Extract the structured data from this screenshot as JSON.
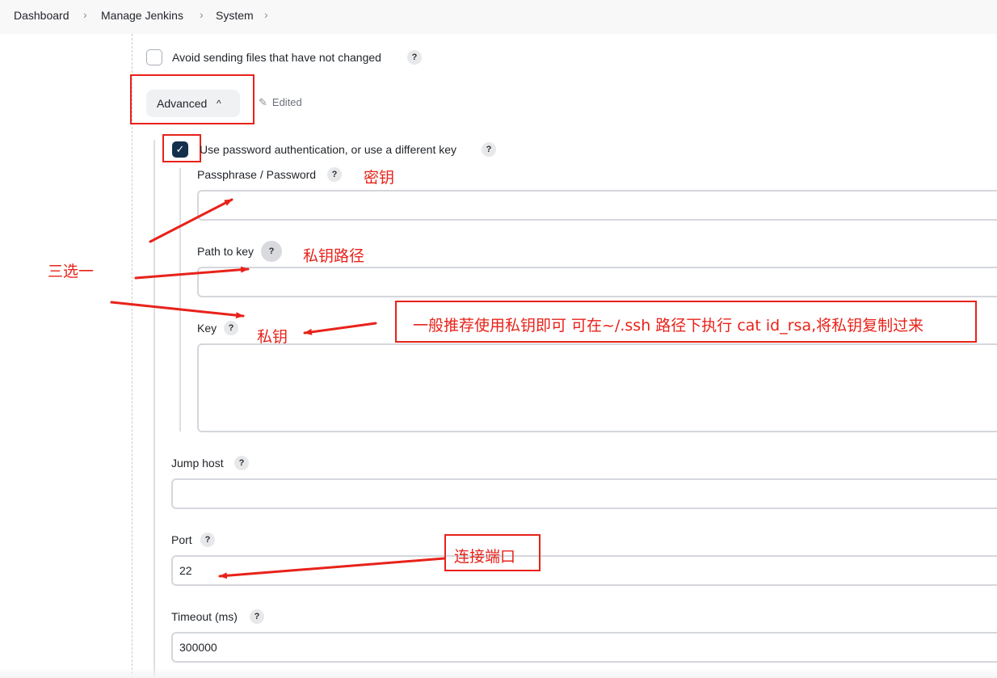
{
  "breadcrumb": {
    "items": [
      "Dashboard",
      "Manage Jenkins",
      "System"
    ]
  },
  "avoid_sending": {
    "label": "Avoid sending files that have not changed",
    "checked": false
  },
  "advanced": {
    "label": "Advanced",
    "edited_label": "Edited"
  },
  "use_password": {
    "label": "Use password authentication, or use a different key",
    "checked": true
  },
  "fields": {
    "passphrase": {
      "label": "Passphrase / Password",
      "value": ""
    },
    "path_to_key": {
      "label": "Path to key",
      "value": ""
    },
    "key": {
      "label": "Key",
      "value": ""
    },
    "jump_host": {
      "label": "Jump host",
      "value": ""
    },
    "port": {
      "label": "Port",
      "value": "22"
    },
    "timeout": {
      "label": "Timeout (ms)",
      "value": "300000"
    }
  },
  "help_glyph": "?",
  "annotations": {
    "passphrase": "密钥",
    "path_to_key": "私钥路径",
    "key": "私钥",
    "choose_one": "三选一",
    "recommend": "一般推荐使用私钥即可 可在~/.ssh 路径下执行 cat id_rsa,将私钥复制过来",
    "port": "连接端口"
  },
  "colors": {
    "annotation_red": "#e8221a",
    "checkbox_checked": "#14304d"
  }
}
